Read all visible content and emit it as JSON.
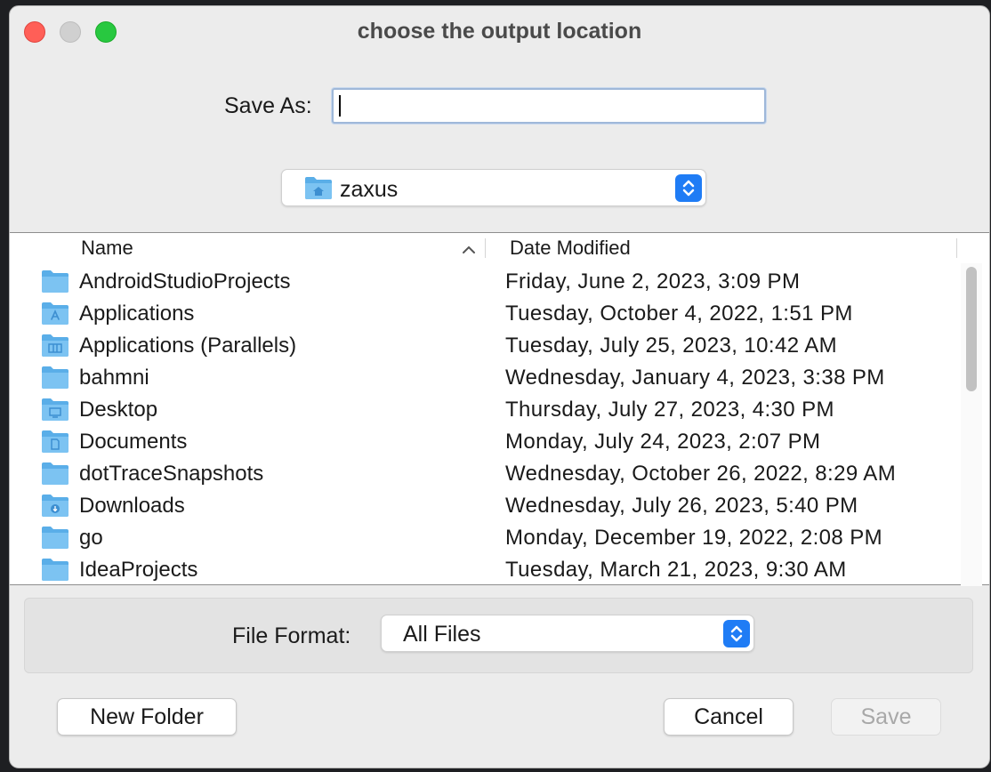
{
  "dialog": {
    "title": "choose the output location"
  },
  "save_as": {
    "label": "Save As:",
    "value": ""
  },
  "location": {
    "current": "zaxus",
    "icon": "home-folder-icon"
  },
  "columns": {
    "name": "Name",
    "date_modified": "Date Modified",
    "sort": "ascending"
  },
  "files": [
    {
      "name": "AndroidStudioProjects",
      "date": "Friday, June 2, 2023, 3:09 PM",
      "icon": "folder-icon"
    },
    {
      "name": "Applications",
      "date": "Tuesday, October 4, 2022, 1:51 PM",
      "icon": "applications-folder-icon"
    },
    {
      "name": "Applications (Parallels)",
      "date": "Tuesday, July 25, 2023, 10:42 AM",
      "icon": "parallels-folder-icon"
    },
    {
      "name": "bahmni",
      "date": "Wednesday, January 4, 2023, 3:38 PM",
      "icon": "folder-icon"
    },
    {
      "name": "Desktop",
      "date": "Thursday, July 27, 2023, 4:30 PM",
      "icon": "desktop-folder-icon"
    },
    {
      "name": "Documents",
      "date": "Monday, July 24, 2023, 2:07 PM",
      "icon": "documents-folder-icon"
    },
    {
      "name": "dotTraceSnapshots",
      "date": "Wednesday, October 26, 2022, 8:29 AM",
      "icon": "folder-icon"
    },
    {
      "name": "Downloads",
      "date": "Wednesday, July 26, 2023, 5:40 PM",
      "icon": "downloads-folder-icon"
    },
    {
      "name": "go",
      "date": "Monday, December 19, 2022, 2:08 PM",
      "icon": "folder-icon"
    },
    {
      "name": "IdeaProjects",
      "date": "Tuesday, March 21, 2023, 9:30 AM",
      "icon": "folder-icon"
    }
  ],
  "file_format": {
    "label": "File Format:",
    "selected": "All Files"
  },
  "buttons": {
    "new_folder": "New Folder",
    "cancel": "Cancel",
    "save": "Save"
  },
  "colors": {
    "accent": "#1f7cf5",
    "folder": "#5aaee8",
    "close": "#ff5f57",
    "maximize": "#28c840"
  }
}
